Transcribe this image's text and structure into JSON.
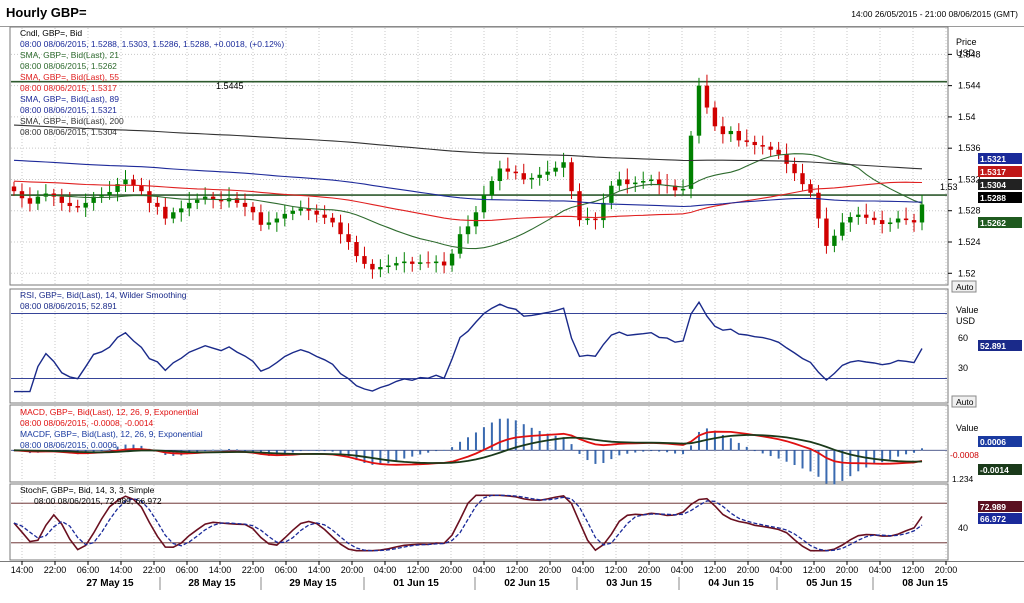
{
  "header": {
    "title": "Hourly GBP=",
    "range": "14:00 26/05/2015 - 21:00 08/06/2015 (GMT)"
  },
  "colors": {
    "up": "#008000",
    "down": "#d00000",
    "sma21": "#2e6b2e",
    "sma55": "#e02020",
    "sma89": "#1e2a9a",
    "sma200": "#333333",
    "rsi": "#1a2a8a",
    "macd": "#e01010",
    "macdSignal": "#1a3a1a",
    "hist": "#3a6ab0",
    "stochK": "#6a1020",
    "stochD": "#1a2a9a",
    "hline": "#2e5a2e",
    "grid": "#c8c8c8"
  },
  "panels": {
    "price": {
      "axis_label": "Price",
      "axis_unit": "USD",
      "legend": [
        "Cndl, GBP=, Bid",
        "08:00 08/06/2015, 1.5288, 1.5303, 1.5286, 1.5288, +0.0018, (+0.12%)",
        "SMA, GBP=, Bid(Last), 21",
        "08:00 08/06/2015, 1.5262",
        "SMA, GBP=, Bid(Last), 55",
        "08:00 08/06/2015, 1.5317",
        "SMA, GBP=, Bid(Last), 89",
        "08:00 08/06/2015, 1.5321",
        "SMA, GBP=, Bid(Last), 200",
        "08:00 08/06/2015, 1.5304"
      ],
      "ticks": [
        "1.548",
        "1.544",
        "1.54",
        "1.536",
        "1.532",
        "1.528",
        "1.524",
        "1.52"
      ],
      "hline_labels": [
        "1.5445",
        "1.53"
      ],
      "badges": [
        "1.5321",
        "1.5317",
        "1.5304",
        "1.5288",
        "1.5262"
      ],
      "auto": "Auto"
    },
    "rsi": {
      "legend": [
        "RSI, GBP=, Bid(Last), 14, Wilder Smoothing",
        "08:00 08/06/2015, 52.891"
      ],
      "axis_label": "Value",
      "axis_unit": "USD",
      "ticks": [
        "60",
        "30"
      ],
      "badge": "52.891",
      "auto": "Auto"
    },
    "macd": {
      "legend": [
        "MACD, GBP=, Bid(Last), 12, 26, 9, Exponential",
        "08:00 08/06/2015, -0.0008, -0.0014",
        "MACDF, GBP=, Bid(Last), 12, 26, 9, Exponential",
        "08:00 08/06/2015, 0.0006"
      ],
      "axis_label": "Value",
      "ticks": [
        "-0.0008",
        "1.234"
      ],
      "badges": [
        "0.0006",
        "-0.0014"
      ]
    },
    "stoch": {
      "legend": [
        "StochF, GBP=, Bid, 14, 3, 3, Simple",
        "08:00 08/06/2015, 72.989, 66.972"
      ],
      "ticks": [
        "40"
      ],
      "badges": [
        "72.989",
        "66.972"
      ]
    }
  },
  "xaxis": {
    "times": [
      "14:00",
      "22:00",
      "06:00",
      "14:00",
      "22:00",
      "06:00",
      "14:00",
      "22:00",
      "06:00",
      "14:00",
      "20:00",
      "04:00",
      "12:00",
      "20:00",
      "04:00",
      "12:00",
      "20:00",
      "04:00",
      "12:00",
      "20:00",
      "04:00",
      "12:00",
      "20:00",
      "04:00",
      "12:00",
      "20:00",
      "04:00",
      "12:00",
      "20:00"
    ],
    "dates": [
      "27 May 15",
      "28 May 15",
      "29 May 15",
      "01 Jun 15",
      "02 Jun 15",
      "03 Jun 15",
      "04 Jun 15",
      "05 Jun 15",
      "08 Jun 15"
    ]
  },
  "chart_data": {
    "type": "candlestick",
    "series_close": [
      1.5305,
      1.5296,
      1.5289,
      1.5298,
      1.5302,
      1.5298,
      1.529,
      1.5286,
      1.5284,
      1.529,
      1.5298,
      1.53,
      1.5304,
      1.5314,
      1.532,
      1.5312,
      1.5305,
      1.529,
      1.5285,
      1.527,
      1.5278,
      1.5283,
      1.529,
      1.5294,
      1.5298,
      1.5295,
      1.5292,
      1.5296,
      1.529,
      1.5285,
      1.5278,
      1.5262,
      1.5265,
      1.527,
      1.5276,
      1.528,
      1.5283,
      1.528,
      1.5275,
      1.5271,
      1.5265,
      1.525,
      1.524,
      1.5222,
      1.5212,
      1.5205,
      1.5208,
      1.521,
      1.5213,
      1.5215,
      1.5212,
      1.5214,
      1.5213,
      1.5215,
      1.521,
      1.5225,
      1.525,
      1.526,
      1.5278,
      1.53,
      1.5318,
      1.5334,
      1.533,
      1.5328,
      1.532,
      1.5322,
      1.5326,
      1.533,
      1.5335,
      1.5342,
      1.5305,
      1.5268,
      1.527,
      1.5268,
      1.529,
      1.5312,
      1.532,
      1.5314,
      1.5316,
      1.5318,
      1.532,
      1.5313,
      1.5312,
      1.5306,
      1.5308,
      1.5376,
      1.544,
      1.5412,
      1.5388,
      1.5378,
      1.5382,
      1.537,
      1.5368,
      1.5364,
      1.5362,
      1.5358,
      1.5352,
      1.534,
      1.5328,
      1.5314,
      1.5303,
      1.527,
      1.5235,
      1.5248,
      1.5265,
      1.5272,
      1.5275,
      1.5271,
      1.5268,
      1.5263,
      1.5265,
      1.527,
      1.5268,
      1.5265,
      1.5288
    ],
    "x_start": "2015-05-26 14:00",
    "x_end": "2015-06-08 21:00",
    "sma": {
      "21": 1.5262,
      "55": 1.5317,
      "89": 1.5321,
      "200": 1.5304
    },
    "ylim": [
      1.5185,
      1.5515
    ],
    "horizontal_lines": [
      1.5445,
      1.53
    ],
    "rsi": {
      "value": 52.891,
      "bands": [
        70,
        30
      ],
      "ylim": [
        15,
        85
      ]
    },
    "macd": {
      "macd": -0.0008,
      "signal": -0.0014,
      "hist": 0.0006
    },
    "stoch": {
      "k": 72.989,
      "d": 66.972,
      "bands": [
        80,
        20
      ]
    }
  }
}
